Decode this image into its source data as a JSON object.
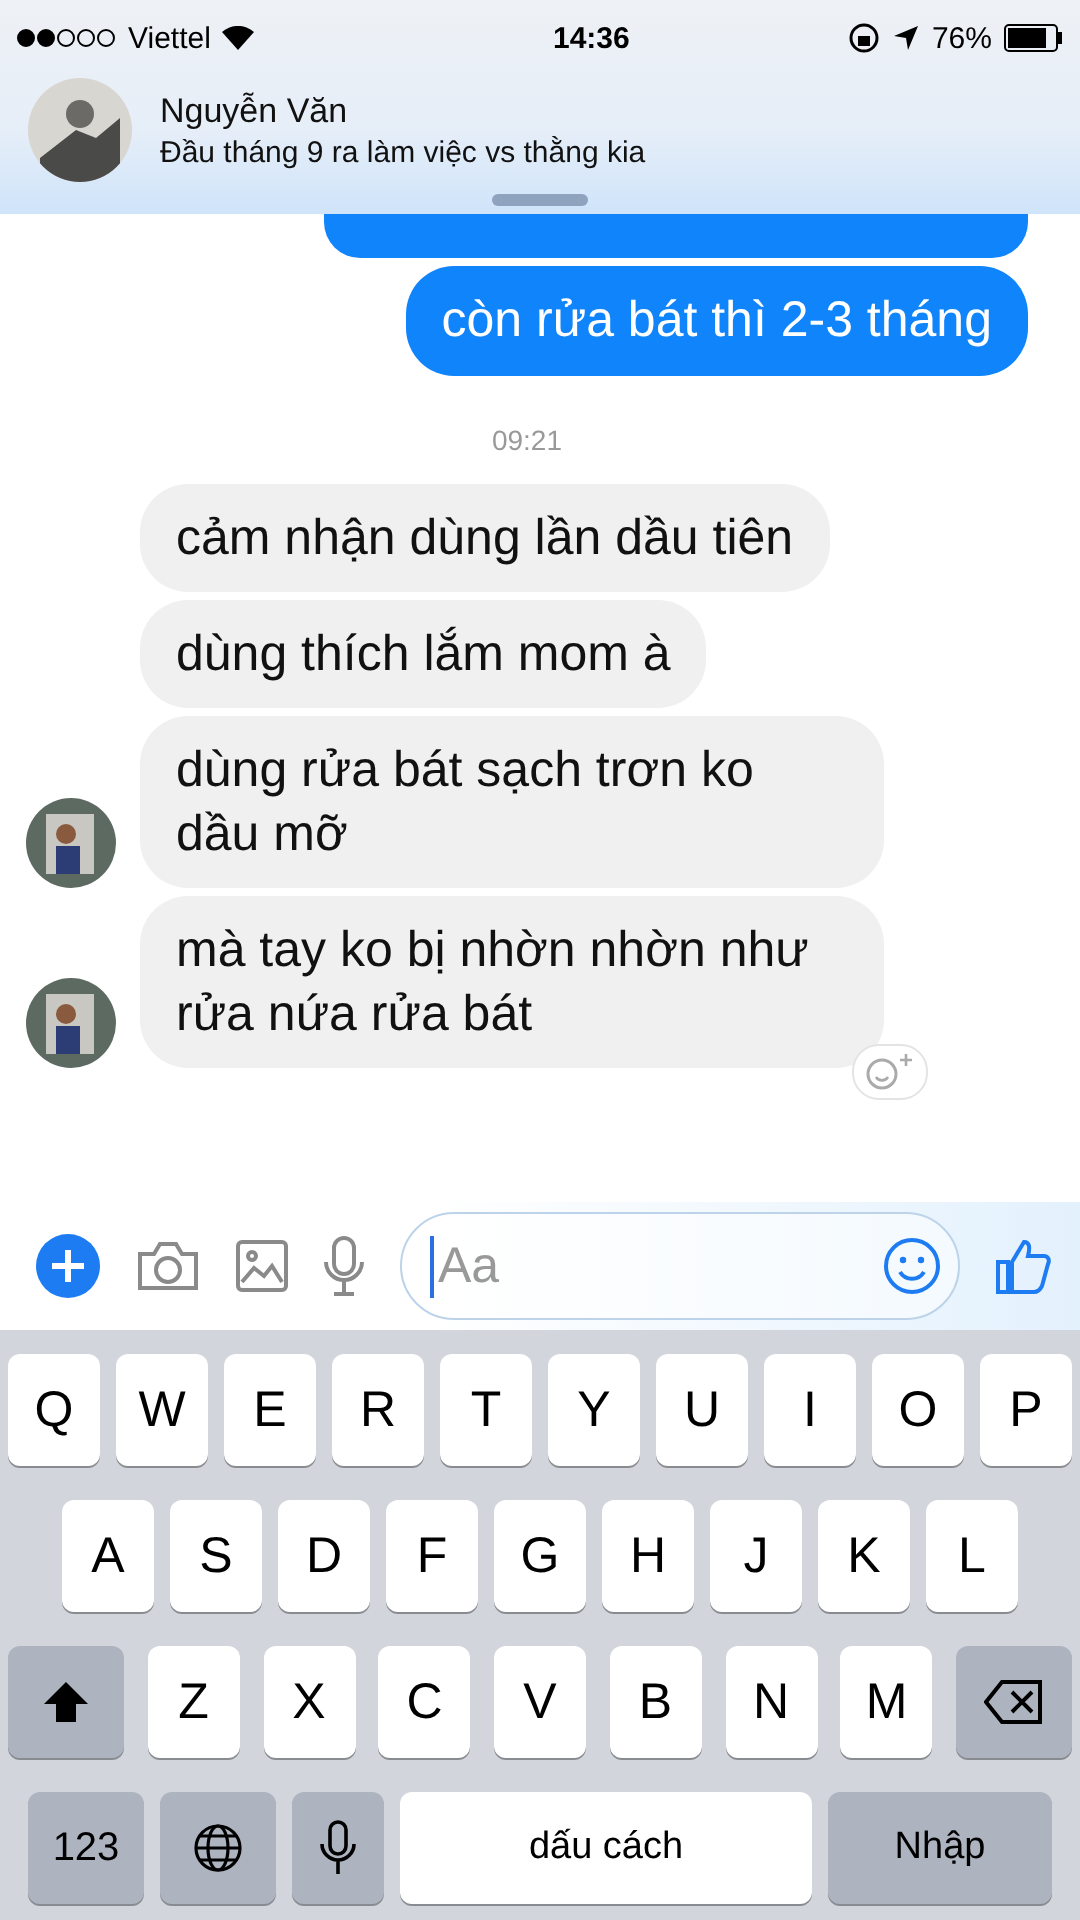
{
  "status_bar": {
    "carrier": "Viettel",
    "time": "14:36",
    "battery": "76%"
  },
  "banner": {
    "name": "Nguyễn Văn",
    "preview": "Đầu tháng 9 ra làm việc vs thằng kia"
  },
  "messages": [
    {
      "kind": "outgoing",
      "text": "còn rửa bát thì 2-3 tháng"
    },
    {
      "kind": "time",
      "text": "09:21"
    },
    {
      "kind": "incoming",
      "text": "cảm nhận dùng lần dầu tiên",
      "avatar": false
    },
    {
      "kind": "incoming",
      "text": "dùng thích lắm mom à",
      "avatar": false
    },
    {
      "kind": "incoming",
      "text": "dùng rửa bát sạch trơn ko dầu mỡ",
      "avatar": true
    },
    {
      "kind": "incoming",
      "text": "mà tay ko bị nhờn nhờn như rửa nứa rửa bát",
      "avatar": true
    }
  ],
  "composer": {
    "placeholder": "Aa"
  },
  "keyboard": [
    [
      {
        "kind": "letter",
        "label": "Q"
      },
      {
        "kind": "letter",
        "label": "W"
      },
      {
        "kind": "letter",
        "label": "E"
      },
      {
        "kind": "letter",
        "label": "R"
      },
      {
        "kind": "letter",
        "label": "T"
      },
      {
        "kind": "letter",
        "label": "Y"
      },
      {
        "kind": "letter",
        "label": "U"
      },
      {
        "kind": "letter",
        "label": "I"
      },
      {
        "kind": "letter",
        "label": "O"
      },
      {
        "kind": "letter",
        "label": "P"
      }
    ],
    [
      {
        "kind": "letter",
        "label": "A"
      },
      {
        "kind": "letter",
        "label": "S"
      },
      {
        "kind": "letter",
        "label": "D"
      },
      {
        "kind": "letter",
        "label": "F"
      },
      {
        "kind": "letter",
        "label": "G"
      },
      {
        "kind": "letter",
        "label": "H"
      },
      {
        "kind": "letter",
        "label": "J"
      },
      {
        "kind": "letter",
        "label": "K"
      },
      {
        "kind": "letter",
        "label": "L"
      }
    ],
    [
      {
        "kind": "shift"
      },
      {
        "kind": "letter",
        "label": "Z"
      },
      {
        "kind": "letter",
        "label": "X"
      },
      {
        "kind": "letter",
        "label": "C"
      },
      {
        "kind": "letter",
        "label": "V"
      },
      {
        "kind": "letter",
        "label": "B"
      },
      {
        "kind": "letter",
        "label": "N"
      },
      {
        "kind": "letter",
        "label": "M"
      },
      {
        "kind": "backspace"
      }
    ],
    [
      {
        "kind": "numbers",
        "label": "123"
      },
      {
        "kind": "globe"
      },
      {
        "kind": "mic"
      },
      {
        "kind": "space",
        "label": "dấu cách"
      },
      {
        "kind": "return",
        "label": "Nhập"
      }
    ]
  ]
}
